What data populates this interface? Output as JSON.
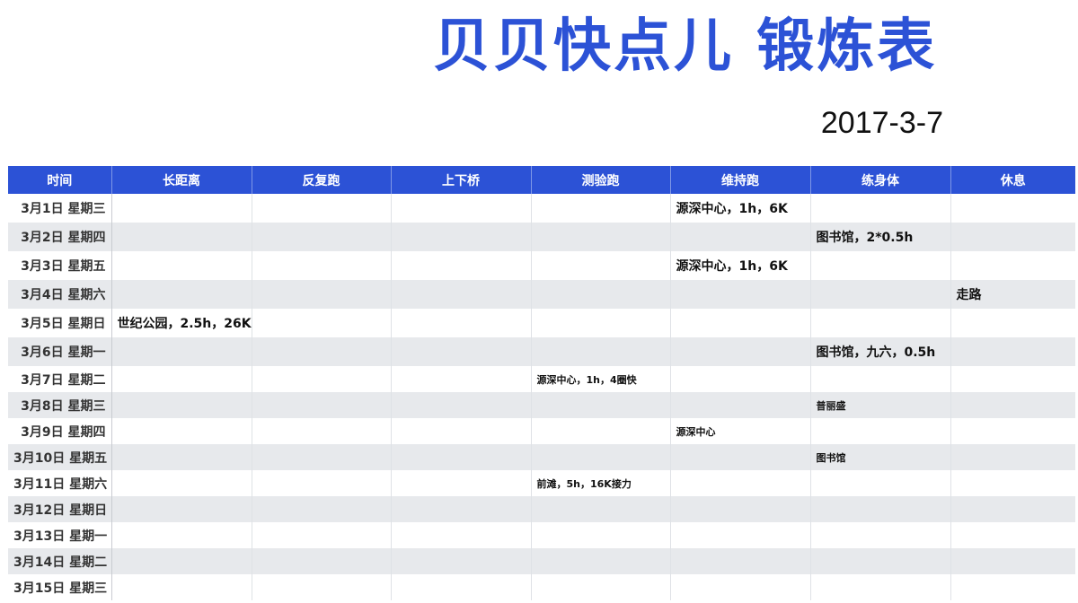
{
  "title": "贝贝快点儿 锻炼表",
  "date": "2017-3-7",
  "columns": [
    "时间",
    "长距离",
    "反复跑",
    "上下桥",
    "测验跑",
    "维持跑",
    "练身体",
    "休息"
  ],
  "rows": [
    {
      "day": "3月1日 星期三",
      "cells": [
        "",
        "",
        "",
        "",
        "源深中心，1h，6K",
        "",
        ""
      ]
    },
    {
      "day": "3月2日 星期四",
      "cells": [
        "",
        "",
        "",
        "",
        "",
        "图书馆，2*0.5h",
        ""
      ]
    },
    {
      "day": "3月3日 星期五",
      "cells": [
        "",
        "",
        "",
        "",
        "源深中心，1h，6K",
        "",
        ""
      ]
    },
    {
      "day": "3月4日 星期六",
      "cells": [
        "",
        "",
        "",
        "",
        "",
        "",
        "走路"
      ]
    },
    {
      "day": "3月5日 星期日",
      "cells": [
        "世纪公园，2.5h，26K",
        "",
        "",
        "",
        "",
        "",
        ""
      ]
    },
    {
      "day": "3月6日 星期一",
      "cells": [
        "",
        "",
        "",
        "",
        "",
        "图书馆，九六，0.5h",
        ""
      ]
    },
    {
      "day": "3月7日 星期二",
      "cells": [
        "",
        "",
        "",
        "源深中心，1h，4圈快",
        "",
        "",
        ""
      ]
    },
    {
      "day": "3月8日 星期三",
      "cells": [
        "",
        "",
        "",
        "",
        "",
        "普丽盛",
        ""
      ]
    },
    {
      "day": "3月9日 星期四",
      "cells": [
        "",
        "",
        "",
        "",
        "源深中心",
        "",
        ""
      ]
    },
    {
      "day": "3月10日 星期五",
      "cells": [
        "",
        "",
        "",
        "",
        "",
        "图书馆",
        ""
      ]
    },
    {
      "day": "3月11日 星期六",
      "cells": [
        "",
        "",
        "",
        "前滩，5h，16K接力",
        "",
        "",
        ""
      ]
    },
    {
      "day": "3月12日 星期日",
      "cells": [
        "",
        "",
        "",
        "",
        "",
        "",
        ""
      ]
    },
    {
      "day": "3月13日 星期一",
      "cells": [
        "",
        "",
        "",
        "",
        "",
        "",
        ""
      ]
    },
    {
      "day": "3月14日 星期二",
      "cells": [
        "",
        "",
        "",
        "",
        "",
        "",
        ""
      ]
    },
    {
      "day": "3月15日 星期三",
      "cells": [
        "",
        "",
        "",
        "",
        "",
        "",
        ""
      ]
    }
  ],
  "colors": {
    "accent": "#2c52d6",
    "stripe": "#e7e9ec"
  }
}
